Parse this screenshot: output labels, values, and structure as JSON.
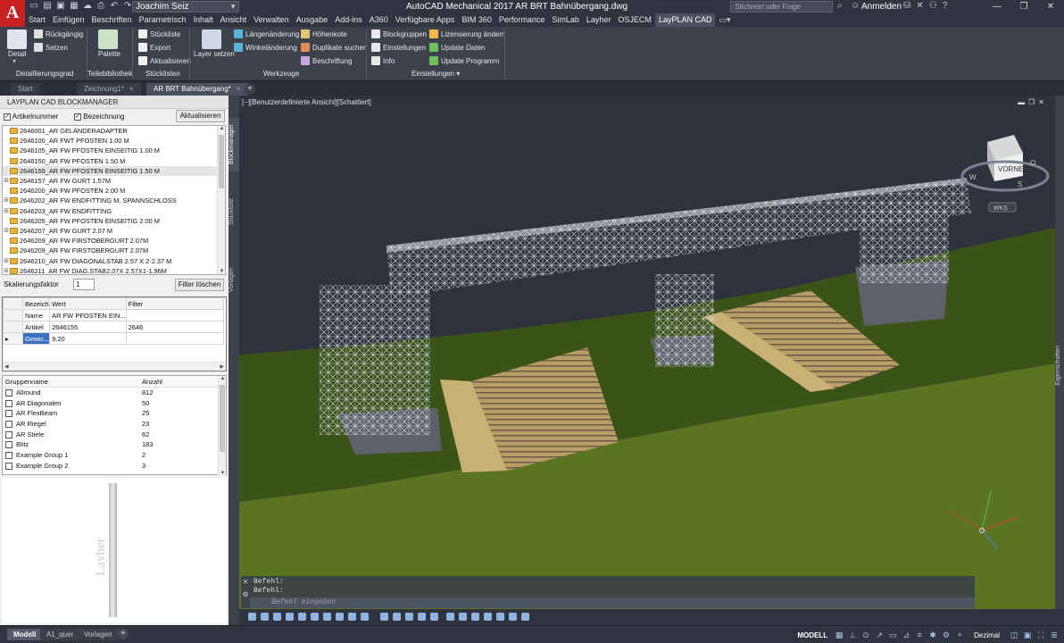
{
  "titlebar": {
    "logo": "A",
    "user_combo": "Joachim Seiz",
    "title": "AutoCAD Mechanical 2017   AR BRT Bahnübergang.dwg",
    "search_placeholder": "Stichwort oder Frage eingeben",
    "login": "Anmelden",
    "window_buttons": [
      "—",
      "❐",
      "✕"
    ]
  },
  "menu_tabs": [
    "Start",
    "Einfügen",
    "Beschriften",
    "Parametrisch",
    "Inhalt",
    "Ansicht",
    "Verwalten",
    "Ausgabe",
    "Add-ins",
    "A360",
    "Verfügbare Apps",
    "BIM 360",
    "Performance",
    "SimLab",
    "Layher",
    "OSJECM",
    "LayPLAN CAD"
  ],
  "active_menu_tab": "LayPLAN CAD",
  "ribbon": {
    "detail": "Detail",
    "rueckgaengig": "Rückgängig",
    "setzen": "Setzen",
    "palette": "Palette",
    "stueckliste": "Stückliste",
    "export": "Export",
    "aktualisieren": "Aktualisieren",
    "layer_setzen": "Layer setzen",
    "laengenaenderung": "Längenänderung",
    "winkelaenderung": "Winkeländerung",
    "hoehenkote": "Höhenkote",
    "duplikate": "Duplikate suchen",
    "beschriftung": "Beschriftung",
    "blockgruppen": "Blockgruppen",
    "einstellungen": "Einstellungen",
    "info": "Info",
    "lizenz": "Lizensierung ändern",
    "update_daten": "Update Daten",
    "update_programm": "Update Programm",
    "panels": {
      "detaillierung": "Detaillierungsgrad",
      "teilebibliothek": "Teilebibliothek",
      "stuecklisten": "Stücklisten",
      "werkzeuge": "Werkzeuge",
      "einstellungen": "Einstellungen ▾"
    }
  },
  "doc_tabs": [
    {
      "label": "Start",
      "active": false
    },
    {
      "label": "Zeichnung1*",
      "active": false
    },
    {
      "label": "AR BRT Bahnübergang*",
      "active": true
    }
  ],
  "palette": {
    "title": "LAYPLAN CAD BLOCKMANAGER",
    "chk_artikel": "Artikelnummer",
    "chk_bezeichnung": "Bezeichnung",
    "aktualisieren": "Aktualisieren",
    "tree": [
      "2646001_AR GELÄNDERADAPTER",
      "2646100_AR FWT PFOSTEN 1.00 M",
      "2646105_AR FW PFOSTEN EINSEITIG 1.00 M",
      "2646150_AR FW PFOSTEN 1.50 M",
      "2646155_AR FW PFOSTEN EINSEITIG 1.50 M",
      "2646157_AR FW GURT 1.57M",
      "2646200_AR FW PFOSTEN 2.00 M",
      "2646202_AR FW ENDFITTING M. SPANNSCHLOSS",
      "2646203_AR FW ENDFITTING",
      "2646205_AR FW PFOSTEN EINSEITIG 2.00 M",
      "2646207_AR FW GURT 2.07 M",
      "2646209_AR FW FIRSTOBERGURT 2.07M",
      "2646209_AR FW FIRSTOBERGURT 2.07M",
      "2646210_AR FW DIAGONALSTAB 2.57 X 2-2.37 M",
      "2646211_AR FW DIAG.STAB2.07X 2.57X1-1.96M"
    ],
    "tree_expandable": [
      false,
      false,
      false,
      false,
      false,
      true,
      false,
      true,
      true,
      false,
      true,
      false,
      false,
      true,
      true
    ],
    "tree_selected_index": 4,
    "scale_label": "Skalierungsfaktor",
    "scale_value": "1",
    "filter_button": "Filter löschen",
    "grid_headers": [
      "Bezeich",
      "Wert",
      "Filter"
    ],
    "grid_rows": [
      {
        "name": "Name",
        "value": "AR FW PFOSTEN EIN...",
        "filter": ""
      },
      {
        "name": "Artikel",
        "value": "2646155",
        "filter": "2646"
      },
      {
        "name": "Gewic...",
        "value": "9.20",
        "filter": ""
      }
    ],
    "group_headers": [
      "Gruppenname",
      "Anzahl"
    ],
    "groups": [
      {
        "name": "Allround",
        "count": "812"
      },
      {
        "name": "AR Diagonalen",
        "count": "50"
      },
      {
        "name": "AR FlexBeam",
        "count": "25"
      },
      {
        "name": "AR Riegel",
        "count": "23"
      },
      {
        "name": "AR Stiele",
        "count": "62"
      },
      {
        "name": "Blitz",
        "count": "183"
      },
      {
        "name": "Example Group 1",
        "count": "2"
      },
      {
        "name": "Example Group 2",
        "count": "3"
      }
    ],
    "preview_stamp": "Layher"
  },
  "side_tabs": [
    "Blockmanager",
    "Stückliste",
    "Vorlagen"
  ],
  "viewport": {
    "label": "[−][Benutzerdefinierte Ansicht][Schattiert]",
    "viewcube_face": "VORNE",
    "compass": [
      "N",
      "W",
      "O",
      "S"
    ],
    "wks": "WKS",
    "props_tab": "Eigenschaften"
  },
  "command": {
    "history": [
      "Befehl:",
      "Befehl:"
    ],
    "placeholder": "Befehl eingeben"
  },
  "status": {
    "layout_tabs": [
      {
        "label": "Modell",
        "active": true
      },
      {
        "label": "A1_quer",
        "active": false
      },
      {
        "label": "Vorlagen",
        "active": false
      }
    ],
    "plus": "+",
    "modell": "MODELL",
    "units": "Dezimal"
  }
}
